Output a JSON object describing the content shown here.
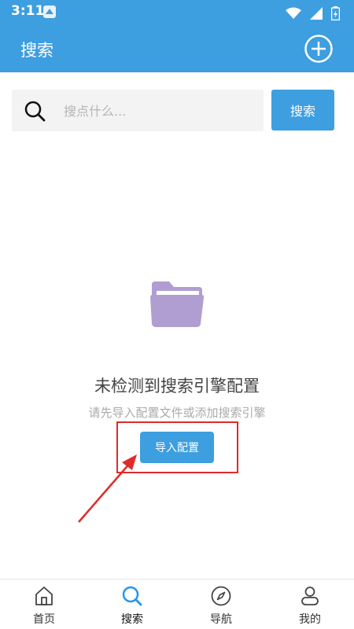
{
  "status_bar": {
    "time": "3:11"
  },
  "header": {
    "title": "搜索"
  },
  "search": {
    "placeholder": "搜点什么...",
    "button_label": "搜索"
  },
  "empty_state": {
    "title": "未检测到搜索引擎配置",
    "subtitle": "请先导入配置文件或添加搜索引擎",
    "import_button_label": "导入配置"
  },
  "bottom_nav": {
    "items": [
      {
        "label": "首页",
        "icon": "home-icon"
      },
      {
        "label": "搜索",
        "icon": "search-icon",
        "active": true
      },
      {
        "label": "导航",
        "icon": "compass-icon"
      },
      {
        "label": "我的",
        "icon": "person-icon"
      }
    ]
  },
  "colors": {
    "primary": "#3d9ee0",
    "folder": "#b09ed2",
    "annotation": "#e02b2b",
    "active_nav": "#2196f3"
  }
}
